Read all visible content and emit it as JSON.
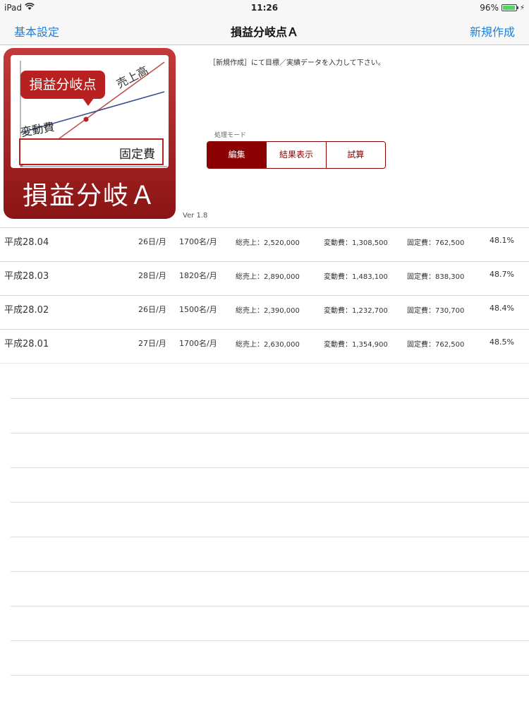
{
  "status_bar": {
    "device": "iPad",
    "time": "11:26",
    "battery": "96%",
    "battery_level": 0.96
  },
  "nav": {
    "left": "基本設定",
    "title": "損益分岐点Ａ",
    "right": "新規作成"
  },
  "app_icon": {
    "bubble": "損益分岐点",
    "sales_label": "売上高",
    "variable_label": "変動費",
    "fixed_label": "固定費",
    "caption": "損益分岐Ａ"
  },
  "version": "Ver 1.8",
  "instruction": "［新規作成］にて目標／実績データを入力して下さい。",
  "mode": {
    "label": "処理モード",
    "options": [
      "編集",
      "結果表示",
      "試算"
    ],
    "selected": "編集"
  },
  "records": [
    {
      "period": "平成28.04",
      "days": "26日/月",
      "people": "1700名/月",
      "sales": "総売上：2,520,000",
      "variable": "変動費：1,308,500",
      "fixed": "固定費：762,500",
      "ratio": "48.1%"
    },
    {
      "period": "平成28.03",
      "days": "28日/月",
      "people": "1820名/月",
      "sales": "総売上：2,890,000",
      "variable": "変動費：1,483,100",
      "fixed": "固定費：838,300",
      "ratio": "48.7%"
    },
    {
      "period": "平成28.02",
      "days": "26日/月",
      "people": "1500名/月",
      "sales": "総売上：2,390,000",
      "variable": "変動費：1,232,700",
      "fixed": "固定費：730,700",
      "ratio": "48.4%"
    },
    {
      "period": "平成28.01",
      "days": "27日/月",
      "people": "1700名/月",
      "sales": "総売上：2,630,000",
      "variable": "変動費：1,354,900",
      "fixed": "固定費：762,500",
      "ratio": "48.5%"
    }
  ],
  "colors": {
    "accent": "#8b0000",
    "link": "#1a82e0",
    "icon_red": "#b92020"
  }
}
